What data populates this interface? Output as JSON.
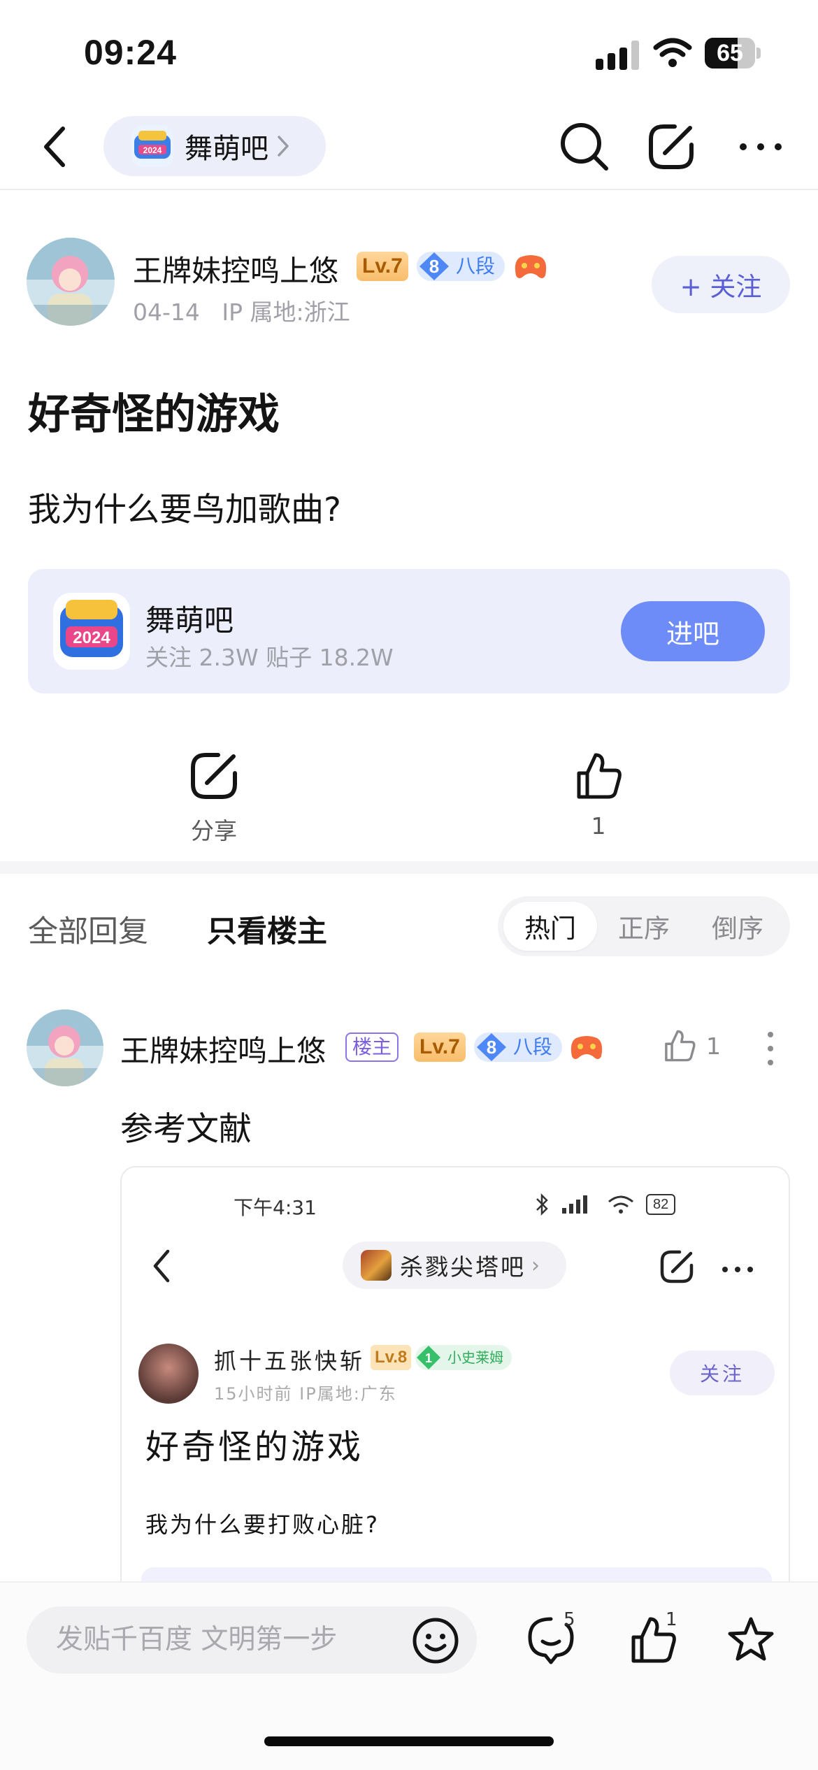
{
  "status_bar": {
    "time": "09:24",
    "battery": "65"
  },
  "nav": {
    "forum_name": "舞萌吧"
  },
  "post": {
    "author": "王牌妹控鸣上悠",
    "level": "Lv.7",
    "rank_num": "8",
    "rank_label": "八段",
    "date": "04-14",
    "ip": "IP 属地:浙江",
    "follow_label": "+ 关注",
    "title": "好奇怪的游戏",
    "body": "我为什么要鸟加歌曲?"
  },
  "forum_card": {
    "name": "舞萌吧",
    "stats": "关注 2.3W   贴子 18.2W",
    "enter_label": "进吧",
    "logo_text": "2024"
  },
  "actions": {
    "share_label": "分享",
    "like_count": "1"
  },
  "replies_header": {
    "all_label": "全部回复",
    "host_only_label": "只看楼主",
    "sort_options": [
      "热门",
      "正序",
      "倒序"
    ]
  },
  "reply": {
    "author": "王牌妹控鸣上悠",
    "host_badge": "楼主",
    "level": "Lv.7",
    "rank_num": "8",
    "rank_label": "八段",
    "like_count": "1",
    "text": "参考文献"
  },
  "embedded_screenshot": {
    "status_time": "下午4:31",
    "battery": "82",
    "forum_name": "杀戮尖塔吧",
    "author": "抓十五张快斩",
    "level": "Lv.8",
    "rank_num": "1",
    "rank_label": "小史莱姆",
    "meta": "15小时前   IP属地:广东",
    "follow_label": "关注",
    "title": "好奇怪的游戏",
    "body": "我为什么要打败心脏?"
  },
  "bottom_bar": {
    "input_placeholder": "发贴千百度 文明第一步",
    "comment_count": "5",
    "like_count": "1"
  },
  "colors": {
    "accent": "#6d8cf7",
    "follow_text": "#5b5fd6",
    "level_badge": "#f8bd6b",
    "rank_badge": "#dfeafe",
    "host_badge": "#8e74e8"
  }
}
